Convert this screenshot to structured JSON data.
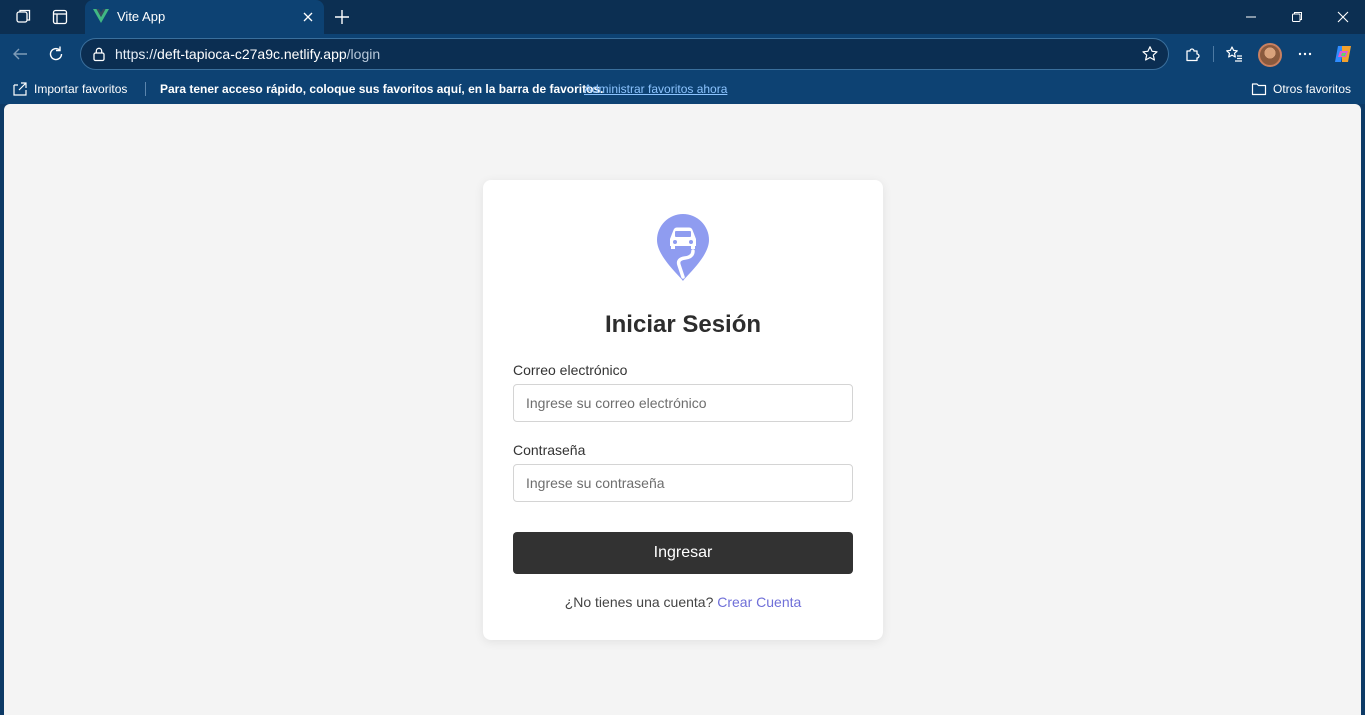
{
  "browser": {
    "tab": {
      "title": "Vite App",
      "favicon": "vue-logo-icon"
    },
    "url": {
      "scheme": "https://",
      "host": "deft-tapioca-c27a9c.netlify.app",
      "path": "/login"
    },
    "favorites_bar": {
      "import_label": "Importar favoritos",
      "message": "Para tener acceso rápido, coloque sus favoritos aquí, en la barra de favoritos.",
      "manage_link": "Administrar favoritos ahora",
      "other_label": "Otros favoritos"
    }
  },
  "login": {
    "title": "Iniciar Sesión",
    "email": {
      "label": "Correo electrónico",
      "placeholder": "Ingrese su correo electrónico"
    },
    "password": {
      "label": "Contraseña",
      "placeholder": "Ingrese su contraseña"
    },
    "submit_label": "Ingresar",
    "signup_prompt": "¿No tienes una cuenta?",
    "signup_link": "Crear Cuenta"
  },
  "colors": {
    "accent": "#6f6fd8",
    "logo": "#8f9cf0",
    "button": "#323232",
    "page_bg": "#f4f4f4",
    "browser_chrome": "#0d4273"
  }
}
